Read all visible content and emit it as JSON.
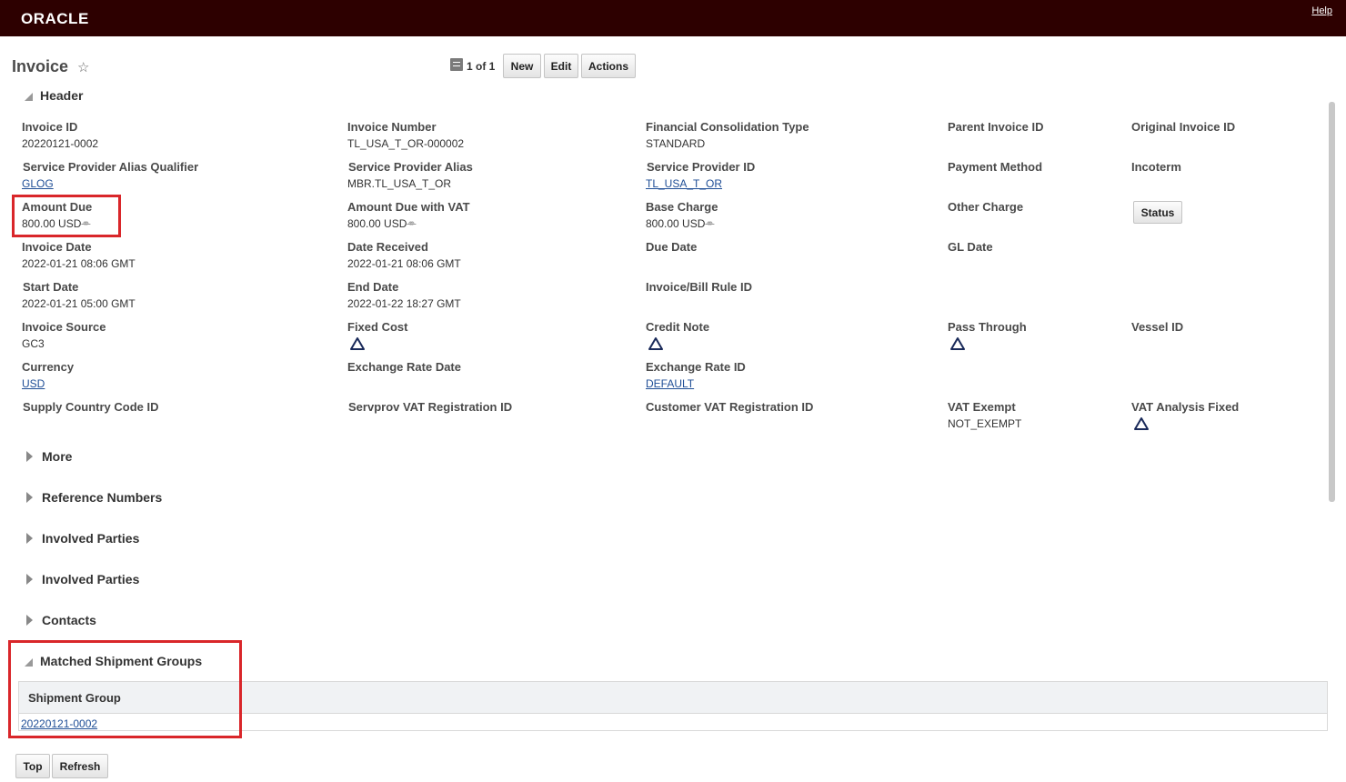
{
  "app": {
    "logo": "ORACLE",
    "help": "Help"
  },
  "page": {
    "title": "Invoice"
  },
  "toolbar": {
    "record_count": "1 of 1",
    "new_label": "New",
    "edit_label": "Edit",
    "actions_label": "Actions"
  },
  "sections": {
    "header": "Header",
    "more": "More",
    "reference_numbers": "Reference Numbers",
    "involved_parties_1": "Involved Parties",
    "involved_parties_2": "Involved Parties",
    "contacts": "Contacts",
    "matched_shipment_groups": "Matched Shipment Groups"
  },
  "fields": {
    "invoice_id": {
      "label": "Invoice ID",
      "value": "20220121-0002"
    },
    "invoice_number": {
      "label": "Invoice Number",
      "value": "TL_USA_T_OR-000002"
    },
    "financial_consolidation_type": {
      "label": "Financial Consolidation Type",
      "value": "STANDARD"
    },
    "parent_invoice_id": {
      "label": "Parent Invoice ID"
    },
    "original_invoice_id": {
      "label": "Original Invoice ID"
    },
    "service_provider_alias_qualifier": {
      "label": "Service Provider Alias Qualifier",
      "value": "GLOG"
    },
    "service_provider_alias": {
      "label": "Service Provider Alias",
      "value": "MBR.TL_USA_T_OR"
    },
    "service_provider_id": {
      "label": "Service Provider ID",
      "value": "TL_USA_T_OR"
    },
    "payment_method": {
      "label": "Payment Method"
    },
    "incoterm": {
      "label": "Incoterm"
    },
    "amount_due": {
      "label": "Amount Due",
      "value": "800.00 USD",
      "suffix": "⚭"
    },
    "amount_due_with_vat": {
      "label": "Amount Due with VAT",
      "value": "800.00 USD",
      "suffix": "⚭"
    },
    "base_charge": {
      "label": "Base Charge",
      "value": "800.00 USD",
      "suffix": "⚭"
    },
    "other_charge": {
      "label": "Other Charge"
    },
    "status_button": "Status",
    "invoice_date": {
      "label": "Invoice Date",
      "value": "2022-01-21 08:06 GMT"
    },
    "date_received": {
      "label": "Date Received",
      "value": "2022-01-21 08:06 GMT"
    },
    "due_date": {
      "label": "Due Date"
    },
    "gl_date": {
      "label": "GL Date"
    },
    "start_date": {
      "label": "Start Date",
      "value": "2022-01-21 05:00 GMT"
    },
    "end_date": {
      "label": "End Date",
      "value": "2022-01-22 18:27 GMT"
    },
    "invoice_bill_rule_id": {
      "label": "Invoice/Bill Rule ID"
    },
    "invoice_source": {
      "label": "Invoice Source",
      "value": "GC3"
    },
    "fixed_cost": {
      "label": "Fixed Cost"
    },
    "credit_note": {
      "label": "Credit Note"
    },
    "pass_through": {
      "label": "Pass Through"
    },
    "vessel_id": {
      "label": "Vessel ID"
    },
    "currency": {
      "label": "Currency",
      "value": "USD"
    },
    "exchange_rate_date": {
      "label": "Exchange Rate Date"
    },
    "exchange_rate_id": {
      "label": "Exchange Rate ID",
      "value": "DEFAULT"
    },
    "supply_country_code_id": {
      "label": "Supply Country Code ID"
    },
    "servprov_vat_registration_id": {
      "label": "Servprov VAT Registration ID"
    },
    "customer_vat_registration_id": {
      "label": "Customer VAT Registration ID"
    },
    "vat_exempt": {
      "label": "VAT Exempt",
      "value": "NOT_EXEMPT"
    },
    "vat_analysis_fixed": {
      "label": "VAT Analysis Fixed"
    }
  },
  "shipment_table": {
    "header": "Shipment Group",
    "rows": [
      "20220121-0002"
    ]
  },
  "footer": {
    "top_label": "Top",
    "refresh_label": "Refresh"
  },
  "colors": {
    "topbar": "#2d0000",
    "highlight": "#d9262a",
    "link": "#1f4e96"
  }
}
